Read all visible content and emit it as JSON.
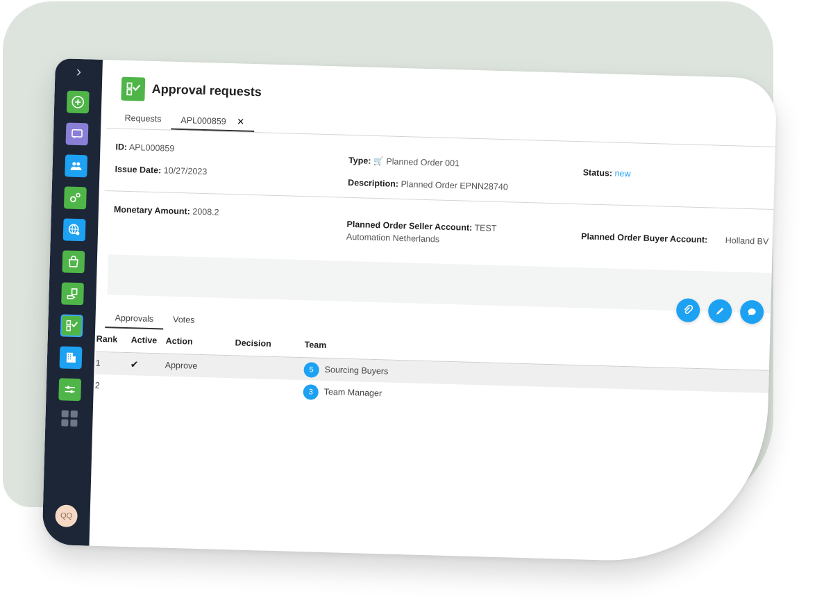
{
  "sidebar": {
    "user_initials": "QQ",
    "items": [
      {
        "icon": "add-circle-icon",
        "color": "#4fb548"
      },
      {
        "icon": "chat-bubble-icon",
        "color": "#8a7fd6"
      },
      {
        "icon": "users-icon",
        "color": "#1da1f2"
      },
      {
        "icon": "gears-icon",
        "color": "#4fb548"
      },
      {
        "icon": "globe-settings-icon",
        "color": "#1da1f2"
      },
      {
        "icon": "shop-icon",
        "color": "#4fb548"
      },
      {
        "icon": "hand-doc-icon",
        "color": "#4fb548"
      },
      {
        "icon": "approval-checklist-icon",
        "color": "#4fb548",
        "active": true
      },
      {
        "icon": "building-icon",
        "color": "#1da1f2"
      },
      {
        "icon": "sliders-icon",
        "color": "#4fb548"
      }
    ]
  },
  "header": {
    "title": "Approval requests"
  },
  "tabs": [
    {
      "label": "Requests"
    },
    {
      "label": "APL000859",
      "active": true,
      "closable": true
    }
  ],
  "details": {
    "id_label": "ID:",
    "id_value": "APL000859",
    "issue_date_label": "Issue Date:",
    "issue_date_value": "10/27/2023",
    "type_label": "Type:",
    "type_value": "Planned Order 001",
    "description_label": "Description:",
    "description_value": "Planned Order EPNN28740",
    "status_label": "Status:",
    "status_value": "new",
    "monetary_label": "Monetary Amount:",
    "monetary_value": "2008.2",
    "seller_label": "Planned Order Seller Account:",
    "seller_value_line1": "TEST",
    "seller_value_line2": "Automation Netherlands",
    "buyer_label": "Planned Order Buyer Account:",
    "buyer_value": "Holland BV"
  },
  "actions": [
    "attach-icon",
    "edit-icon",
    "comment-icon"
  ],
  "sub_tabs": [
    {
      "label": "Approvals",
      "active": true
    },
    {
      "label": "Votes"
    }
  ],
  "approvals_table": {
    "columns": [
      "Rank",
      "Active",
      "Action",
      "Decision",
      "Team"
    ],
    "rows": [
      {
        "rank": "1",
        "active": true,
        "action": "Approve",
        "decision": "",
        "team_count": "5",
        "team_name": "Sourcing Buyers"
      },
      {
        "rank": "2",
        "active": false,
        "action": "",
        "decision": "",
        "team_count": "3",
        "team_name": "Team Manager"
      }
    ]
  }
}
